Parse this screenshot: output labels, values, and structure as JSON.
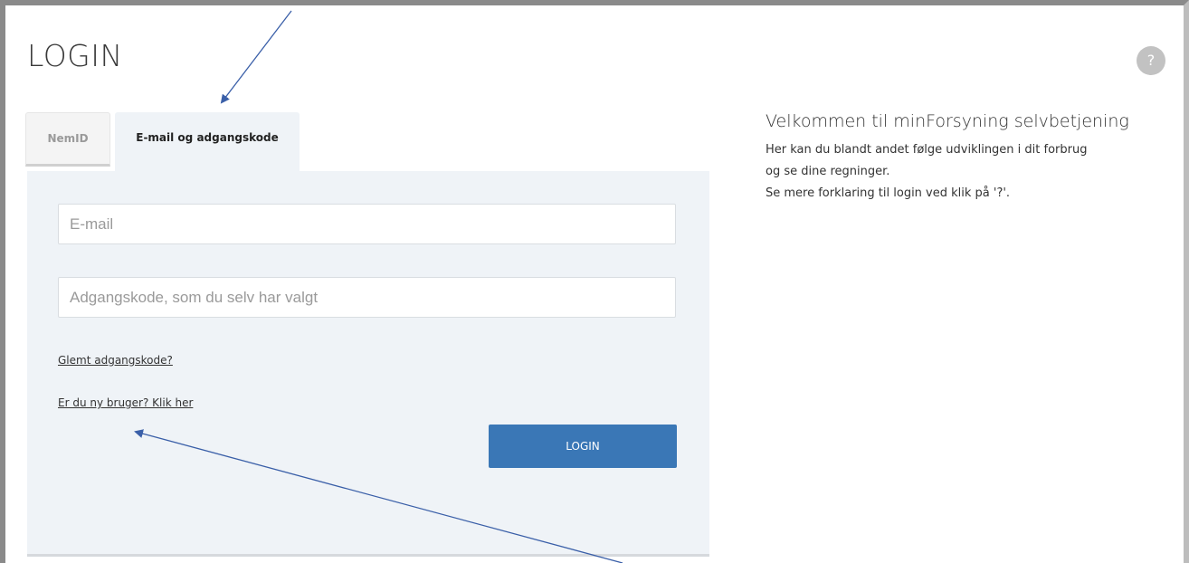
{
  "header": {
    "title": "LOGIN",
    "help_label": "?"
  },
  "tabs": [
    {
      "label": "NemID",
      "active": false
    },
    {
      "label": "E-mail og adgangskode",
      "active": true
    }
  ],
  "form": {
    "email_placeholder": "E-mail",
    "email_value": "",
    "password_placeholder": "Adgangskode, som du selv har valgt",
    "password_value": "",
    "forgot_link": "Glemt adgangskode?",
    "new_user_link": "Er du ny bruger? Klik her",
    "login_button": "LOGIN"
  },
  "welcome": {
    "heading": "Velkommen til minForsyning selvbetjening",
    "lines": [
      "Her kan du blandt andet følge udviklingen i dit forbrug",
      "og se dine regninger.",
      "Se mere forklaring til login ved klik på '?'."
    ]
  },
  "colors": {
    "accent": "#3a77b6",
    "panel_background": "#eff3f7",
    "annotation_arrow": "#3a5fa8"
  }
}
